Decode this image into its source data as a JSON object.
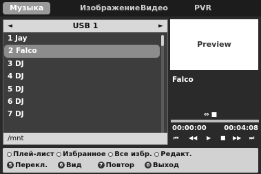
{
  "tabs": {
    "music": "Музыка",
    "image": "Изображение",
    "video": "Видео",
    "pvr": "PVR"
  },
  "device": {
    "name": "USB 1",
    "left_arrow": "◄",
    "right_arrow": "►"
  },
  "list": {
    "items": [
      {
        "label": "1 Jay"
      },
      {
        "label": "2 Falco"
      },
      {
        "label": "3 DJ"
      },
      {
        "label": "4 DJ"
      },
      {
        "label": "5 DJ"
      },
      {
        "label": "6 DJ"
      },
      {
        "label": "7 DJ"
      }
    ],
    "selected_index": 1,
    "path": "/mnt"
  },
  "preview": {
    "label": "Preview",
    "track": "Falco",
    "icons": "⇔ ■",
    "progress_fraction": 0.0,
    "time_elapsed": "00:00:00",
    "time_total": "00:04:08",
    "controls": [
      "⏮",
      "◀◀",
      "▶",
      "■",
      "▶▶",
      "⏭"
    ]
  },
  "help": {
    "playlist": "Плей-лист",
    "favorites": "Избранное",
    "all_selected": "Все избр.",
    "edit": "Редакт.",
    "switch_key": "5",
    "switch": "Перекл.",
    "view_key": "6",
    "view": "Вид",
    "repeat_key": "7",
    "repeat": "Повтор",
    "exit_key": "0",
    "exit": "Выход"
  },
  "colors": {
    "background": "#2a2a2a",
    "selected_row": "#8c8c8c",
    "header_bar": "#d8d8d8"
  }
}
